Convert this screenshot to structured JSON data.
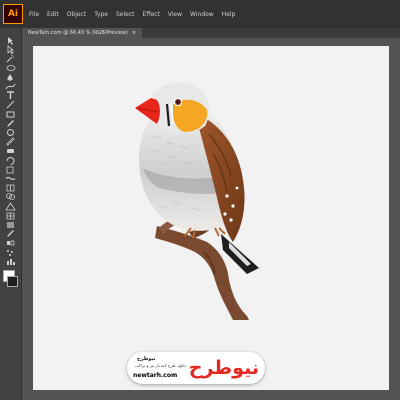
{
  "app": {
    "logo_text": "Ai",
    "menu": [
      "File",
      "Edit",
      "Object",
      "Type",
      "Select",
      "Effect",
      "View",
      "Window",
      "Help"
    ]
  },
  "document_tab": {
    "title": "NewTarh.com @ 66.43 % (RGB/Preview)",
    "close_glyph": "×"
  },
  "toolbar": {
    "tools": [
      "selection-icon",
      "direct-selection-icon",
      "magic-wand-icon",
      "lasso-icon",
      "pen-icon",
      "curvature-icon",
      "type-icon",
      "line-segment-icon",
      "rectangle-icon",
      "paintbrush-icon",
      "shaper-icon",
      "pencil-icon",
      "eraser-icon",
      "rotate-icon",
      "scale-icon",
      "width-icon",
      "free-transform-icon",
      "shape-builder-icon",
      "perspective-grid-icon",
      "mesh-icon",
      "gradient-icon",
      "eyedropper-icon",
      "blend-icon",
      "symbol-sprayer-icon",
      "column-graph-icon"
    ],
    "fill_color": "#ffffff",
    "stroke_color": "#1e1e1e"
  },
  "artwork": {
    "subject": "zebra finch illustration",
    "colors": {
      "beak": "#e8251b",
      "cheek": "#f5a623",
      "breast": "#dcdcdc",
      "wing": "#8b4a22",
      "branch": "#7a4a30"
    }
  },
  "watermark": {
    "logo_text": "نیوطرح",
    "brand": "نیوطرح",
    "tagline": "دانلود طرح لایه باز بنر و تراکت",
    "url": "newtarh.com"
  }
}
